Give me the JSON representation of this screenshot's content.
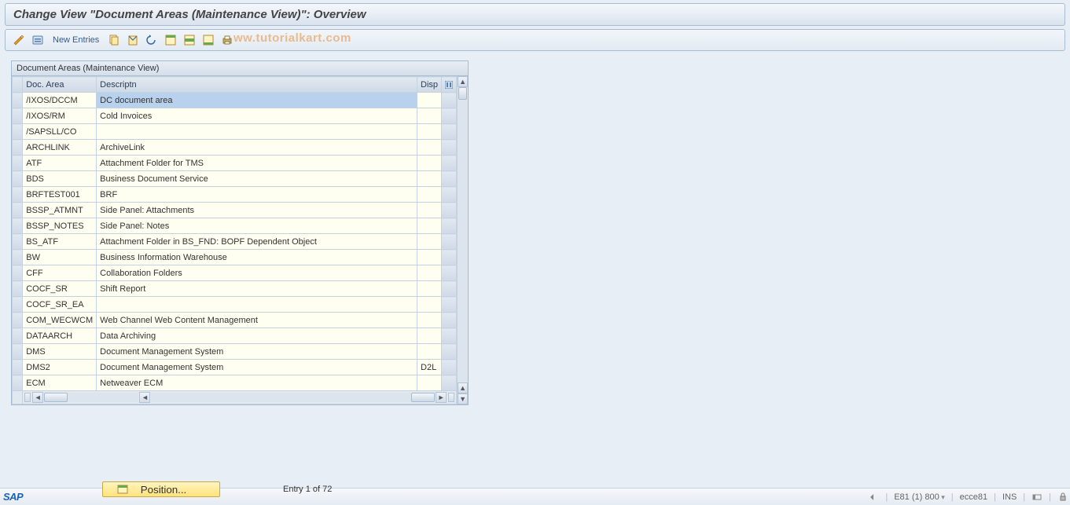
{
  "title": "Change View \"Document Areas (Maintenance View)\": Overview",
  "toolbar": {
    "new_entries": "New Entries"
  },
  "watermark": "ww.tutorialkart.com",
  "table": {
    "title": "Document Areas (Maintenance View)",
    "columns": {
      "doc_area": "Doc. Area",
      "descriptn": "Descriptn",
      "disp": "Disp"
    },
    "rows": [
      {
        "area": "/IXOS/DCCM",
        "desc": "DC document area",
        "disp": "",
        "selected": true
      },
      {
        "area": "/IXOS/RM",
        "desc": "Cold Invoices",
        "disp": ""
      },
      {
        "area": "/SAPSLL/CO",
        "desc": "",
        "disp": ""
      },
      {
        "area": "ARCHLINK",
        "desc": "ArchiveLink",
        "disp": ""
      },
      {
        "area": "ATF",
        "desc": "Attachment Folder for TMS",
        "disp": ""
      },
      {
        "area": "BDS",
        "desc": "Business Document Service",
        "disp": ""
      },
      {
        "area": "BRFTEST001",
        "desc": "BRF",
        "disp": ""
      },
      {
        "area": "BSSP_ATMNT",
        "desc": "Side Panel: Attachments",
        "disp": ""
      },
      {
        "area": "BSSP_NOTES",
        "desc": "Side Panel: Notes",
        "disp": ""
      },
      {
        "area": "BS_ATF",
        "desc": "Attachment Folder in BS_FND: BOPF Dependent Object",
        "disp": ""
      },
      {
        "area": "BW",
        "desc": "Business Information Warehouse",
        "disp": ""
      },
      {
        "area": "CFF",
        "desc": "Collaboration Folders",
        "disp": ""
      },
      {
        "area": "COCF_SR",
        "desc": "Shift Report",
        "disp": ""
      },
      {
        "area": "COCF_SR_EA",
        "desc": "",
        "disp": ""
      },
      {
        "area": "COM_WECWCM",
        "desc": "Web Channel Web Content Management",
        "disp": ""
      },
      {
        "area": "DATAARCH",
        "desc": "Data Archiving",
        "disp": ""
      },
      {
        "area": "DMS",
        "desc": "Document Management System",
        "disp": ""
      },
      {
        "area": "DMS2",
        "desc": "Document Management System",
        "disp": "D2L"
      },
      {
        "area": "ECM",
        "desc": "Netweaver ECM",
        "disp": ""
      }
    ]
  },
  "position_label": "Position...",
  "entry_text": "Entry 1 of 72",
  "status": {
    "system": "E81 (1) 800",
    "server": "ecce81",
    "mode": "INS"
  }
}
